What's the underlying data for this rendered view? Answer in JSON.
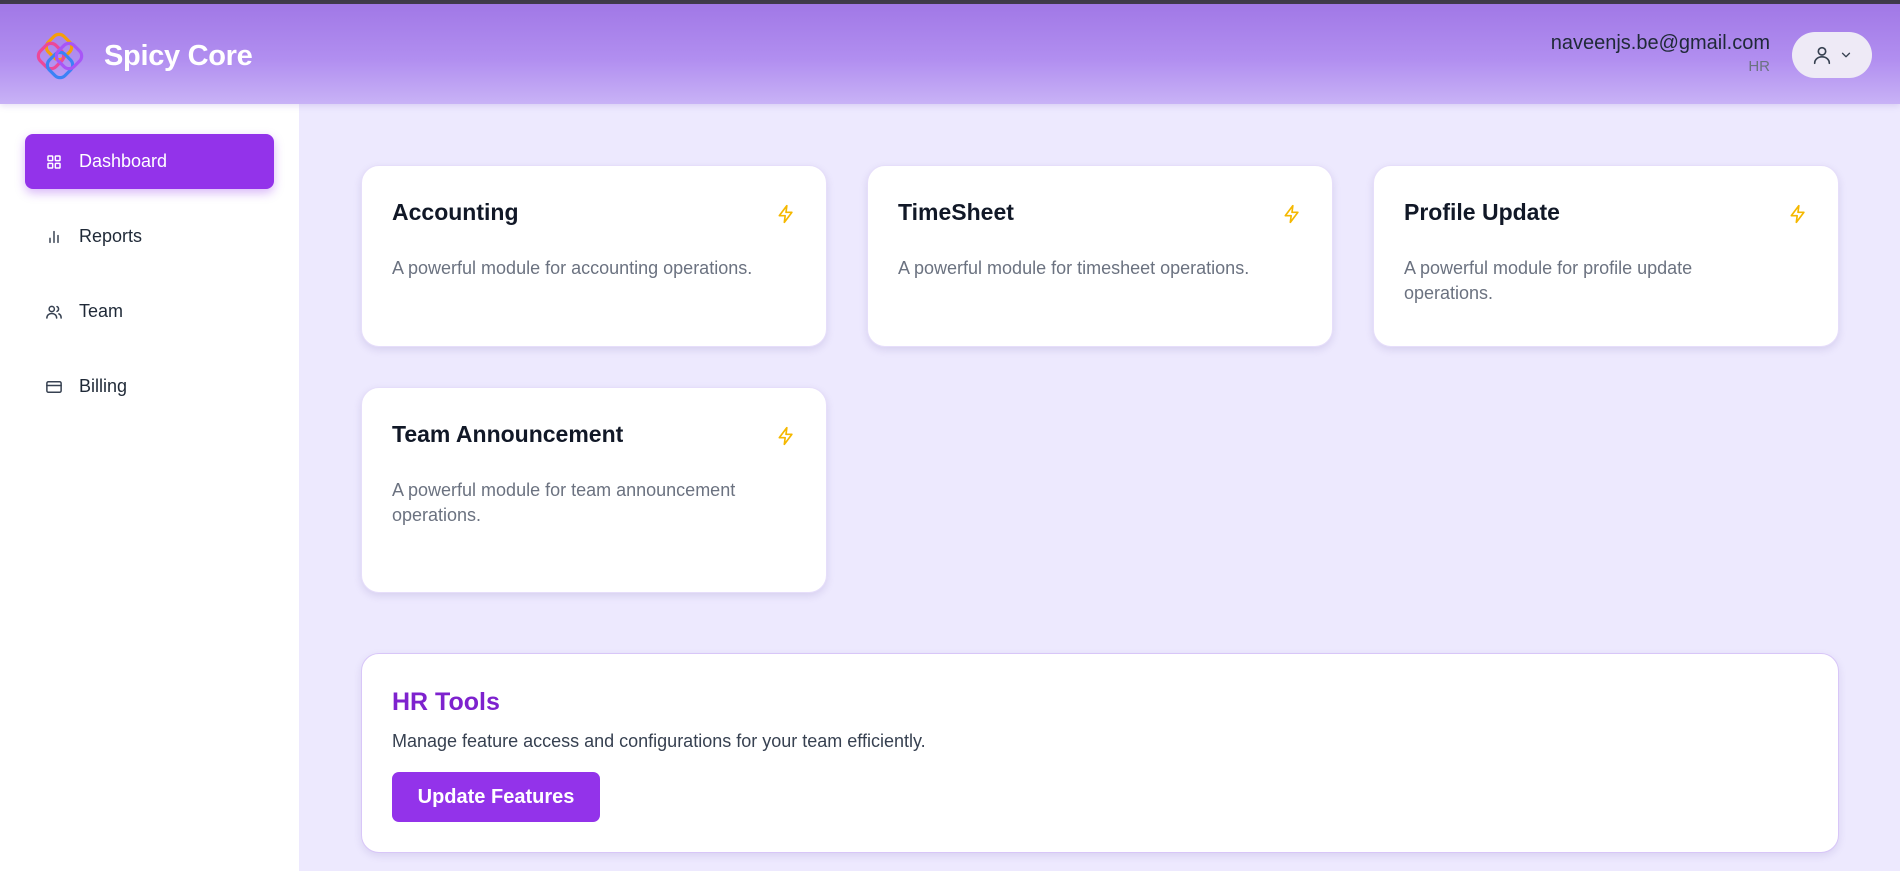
{
  "app": {
    "name": "Spicy Core"
  },
  "header": {
    "user_email": "naveenjs.be@gmail.com",
    "user_role": "HR"
  },
  "sidebar": {
    "items": [
      {
        "label": "Dashboard",
        "icon": "dashboard-grid-icon",
        "active": true
      },
      {
        "label": "Reports",
        "icon": "bar-chart-icon",
        "active": false
      },
      {
        "label": "Team",
        "icon": "users-icon",
        "active": false
      },
      {
        "label": "Billing",
        "icon": "credit-card-icon",
        "active": false
      }
    ]
  },
  "modules": [
    {
      "title": "Accounting",
      "description": "A powerful module for accounting operations.",
      "icon": "lightning-bolt-icon"
    },
    {
      "title": "TimeSheet",
      "description": "A powerful module for timesheet operations.",
      "icon": "lightning-bolt-icon"
    },
    {
      "title": "Profile Update",
      "description": "A powerful module for profile update operations.",
      "icon": "lightning-bolt-icon"
    },
    {
      "title": "Team Announcement",
      "description": "A powerful module for team announcement operations.",
      "icon": "lightning-bolt-icon"
    }
  ],
  "hr_tools": {
    "title": "HR Tools",
    "description": "Manage feature access and configurations for your team efficiently.",
    "button_label": "Update Features"
  },
  "colors": {
    "accent": "#9333ea",
    "accent_title": "#7e22ce",
    "header_gradient_top": "#a178e6",
    "page_background": "#ede9fe",
    "bolt": "#f5b800"
  }
}
